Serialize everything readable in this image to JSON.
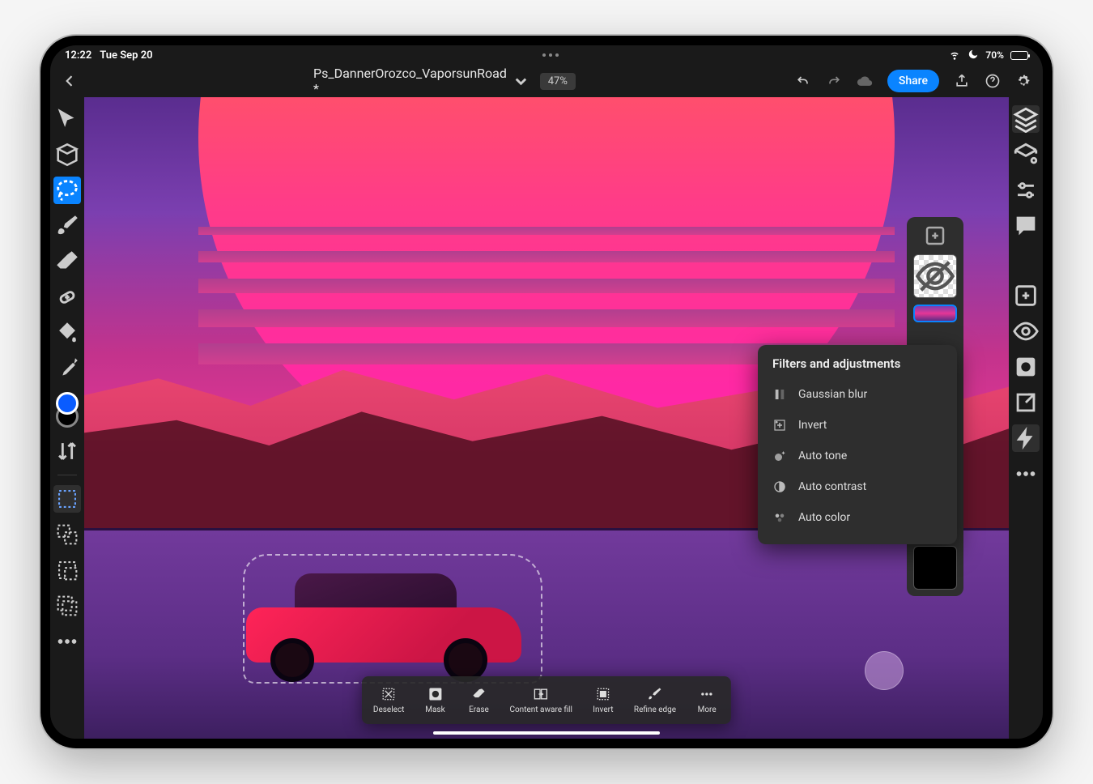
{
  "status": {
    "time": "12:22",
    "date": "Tue Sep 20",
    "battery": "70%"
  },
  "header": {
    "doc_title": "Ps_DannerOrozco_VaporsunRoad *",
    "zoom": "47%",
    "share": "Share"
  },
  "action_bar": {
    "deselect": "Deselect",
    "mask": "Mask",
    "erase": "Erase",
    "content_aware": "Content aware fill",
    "invert": "Invert",
    "refine": "Refine edge",
    "more": "More"
  },
  "popover": {
    "title": "Filters and adjustments",
    "gaussian": "Gaussian blur",
    "invert": "Invert",
    "auto_tone": "Auto tone",
    "auto_contrast": "Auto contrast",
    "auto_color": "Auto color"
  }
}
